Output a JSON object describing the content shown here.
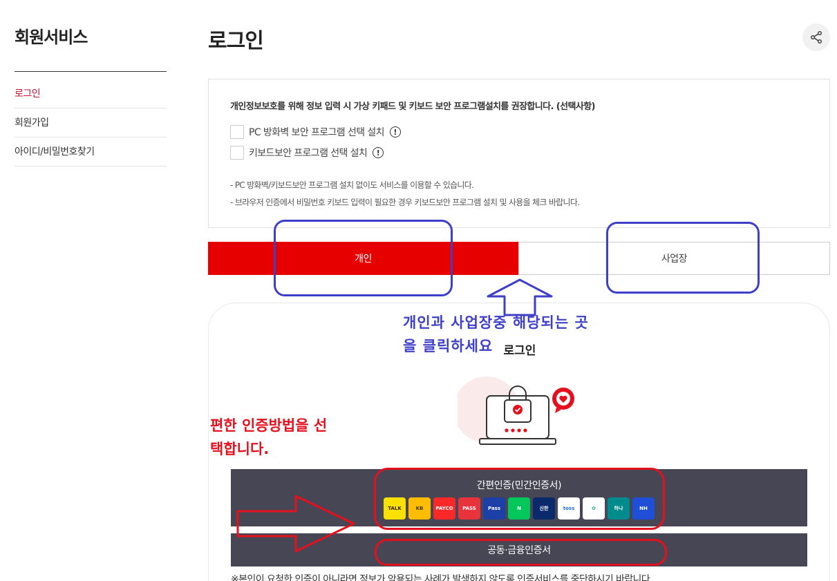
{
  "sidebar": {
    "title": "회원서비스",
    "items": [
      {
        "label": "로그인",
        "active": true
      },
      {
        "label": "회원가입"
      },
      {
        "label": "아이디/비밀번호찾기"
      }
    ]
  },
  "page": {
    "title": "로그인",
    "share_icon": "share-icon"
  },
  "notice": {
    "text": "개인정보보호를 위해 정보 입력 시 가상 키패드 및 키보드 보안 프로그램설치를 권장합니다. (선택사항)",
    "options": [
      {
        "label": "PC 방화벽 보안 프로그램 선택 설치",
        "checked": false
      },
      {
        "label": "키보드보안 프로그램 선택 설치",
        "checked": false
      }
    ],
    "info_glyph": "!",
    "notes": [
      "- PC 방화벽/키보드보안 프로그램 설치 없이도 서비스를 이용할 수 있습니다.",
      "- 브라우저 인증에서 비밀번호 키보드 입력이 필요한 경우 키보드보안 프로그램 설치 및 사용을 체크 바랍니다."
    ]
  },
  "tabs": {
    "personal": "개인",
    "business": "사업장",
    "active": "personal"
  },
  "login": {
    "heading": "로그인",
    "simple_auth_label": "간편인증(민간인증서)",
    "providers": [
      {
        "name": "kakao-talk-icon",
        "text": "TALK",
        "bg": "#fae100",
        "fg": "#3c1e1e"
      },
      {
        "name": "kb-icon",
        "text": "KB",
        "bg": "#ffbc00",
        "fg": "#3b3b3b"
      },
      {
        "name": "payco-icon",
        "text": "PAYCO",
        "bg": "#fa2828",
        "fg": "#ffffff"
      },
      {
        "name": "pass-icon",
        "text": "PASS",
        "bg": "#e8323c",
        "fg": "#ffffff"
      },
      {
        "name": "samsung-pass-icon",
        "text": "Pass",
        "bg": "#1c3fa8",
        "fg": "#ffffff"
      },
      {
        "name": "naver-icon",
        "text": "N",
        "bg": "#03c75a",
        "fg": "#ffffff"
      },
      {
        "name": "shinhan-icon",
        "text": "신한",
        "bg": "#0a2a6b",
        "fg": "#ffffff"
      },
      {
        "name": "toss-icon",
        "text": "toss",
        "bg": "#ffffff",
        "fg": "#1f6fe5"
      },
      {
        "name": "kftc-icon",
        "text": "✿",
        "bg": "#ffffff",
        "fg": "#20b67a"
      },
      {
        "name": "hana-icon",
        "text": "하나",
        "bg": "#008c8c",
        "fg": "#ffffff"
      },
      {
        "name": "nh-icon",
        "text": "NH",
        "bg": "#1f4fd6",
        "fg": "#ffffff"
      }
    ],
    "cert_label": "공동·금융인증서",
    "bottom_note": "※본인이 요청한 인증이 아니라면 정보가 악용되는 사례가 발생하지 않도록 인증서비스를 중단하시기 바랍니다."
  },
  "annotations": {
    "blue_text_line1": "개인과 사업장중 해당되는 곳",
    "blue_text_line2": "을 클릭하세요",
    "red_text_line1": "편한 인증방법을 선",
    "red_text_line2": "택합니다.",
    "blue_color": "#3d3fc7",
    "red_color": "#e4101e"
  },
  "colors": {
    "accent_red": "#e60000",
    "active_link": "#c8102e",
    "method_bg": "#474655"
  }
}
